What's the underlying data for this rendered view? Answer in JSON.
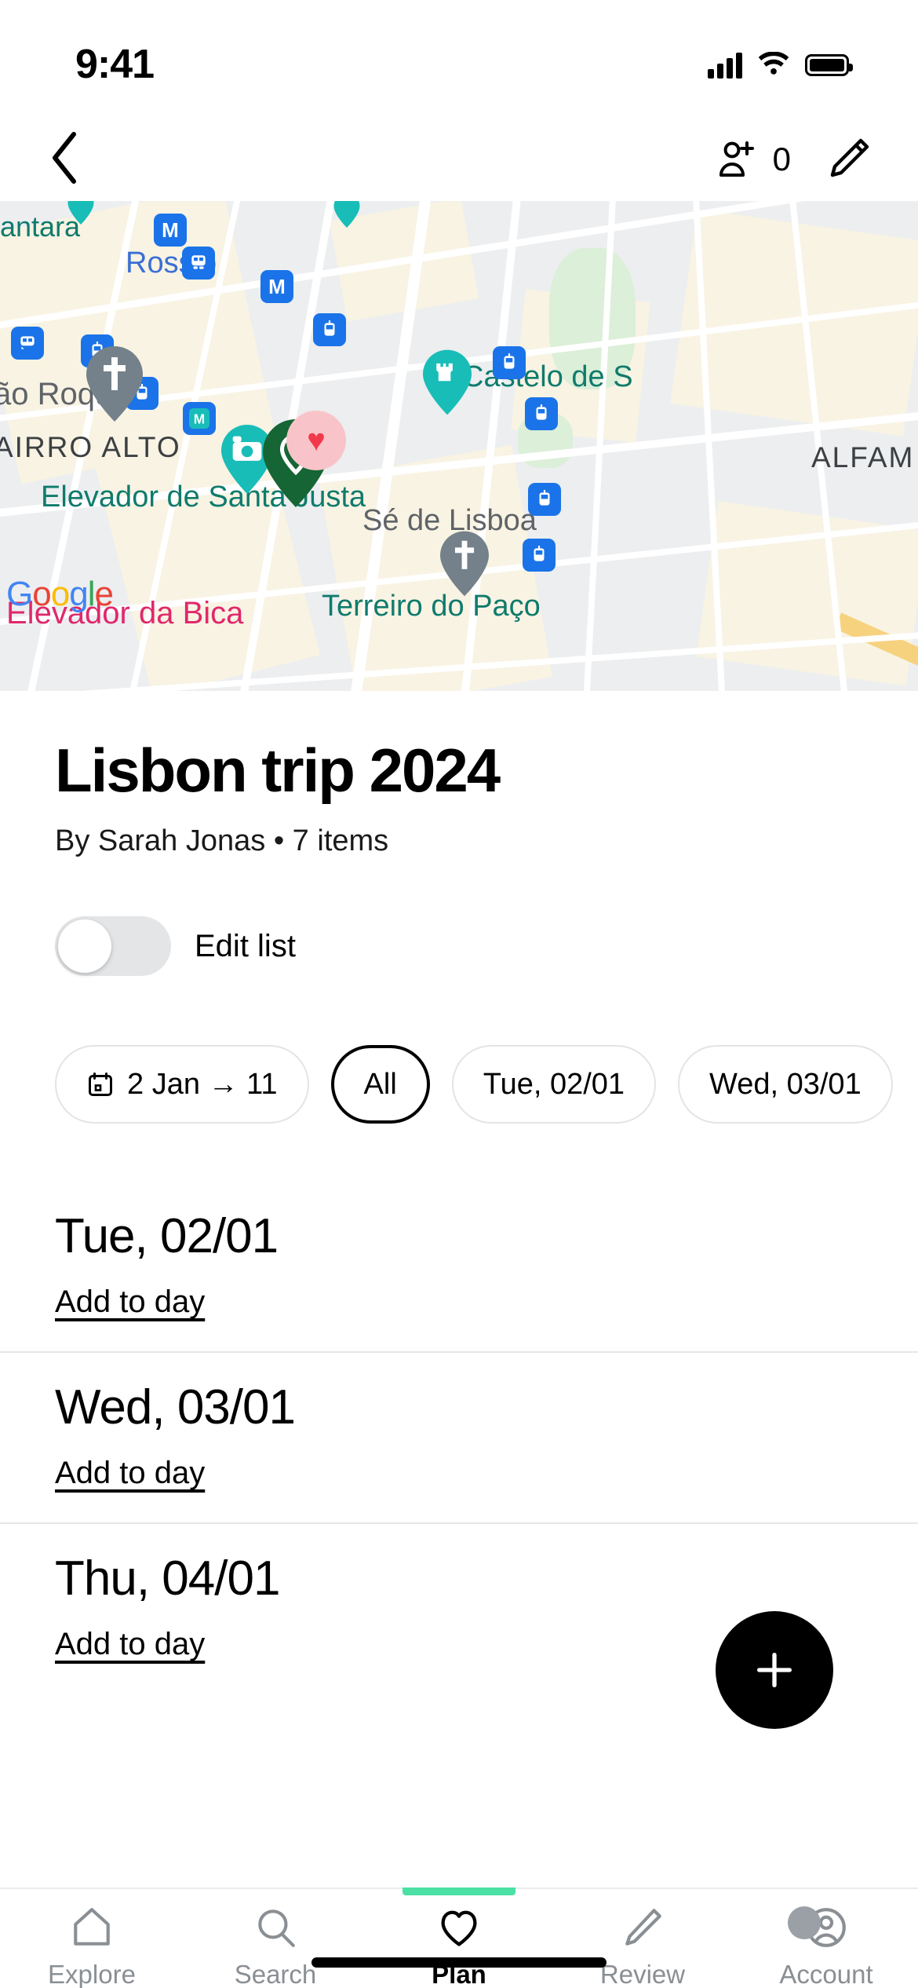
{
  "status_bar": {
    "time": "9:41",
    "signal_icon": "cellular-signal-icon",
    "wifi_icon": "wifi-icon",
    "battery_icon": "battery-icon"
  },
  "nav_bar": {
    "back_icon": "chevron-left-icon",
    "add_person_icon": "person-add-icon",
    "collaborator_count": "0",
    "edit_icon": "pencil-icon"
  },
  "map": {
    "provider": "Google",
    "provider_letters": [
      "G",
      "o",
      "o",
      "g",
      "l",
      "e"
    ],
    "labels": [
      {
        "text": "antara",
        "color": "#0f7b6c"
      },
      {
        "text": "Rossio",
        "color": "#3b6fd4"
      },
      {
        "text": "ão Roque",
        "color": "#5f6368"
      },
      {
        "text": "AIRRO ALTO",
        "color": "#3c4043"
      },
      {
        "text": "Elevador de Santa Justa",
        "color": "#0f7b6c"
      },
      {
        "text": "Castelo de S",
        "color": "#0f7b6c"
      },
      {
        "text": "ALFAM",
        "color": "#3c4043"
      },
      {
        "text": "Sé de Lisboa",
        "color": "#5f6368"
      },
      {
        "text": "Terreiro do Paço",
        "color": "#0f7b6c"
      },
      {
        "text": "Elevador da Bica",
        "color": "#e0286b"
      }
    ],
    "pins": [
      {
        "name": "church-pin",
        "glyph": "✝",
        "color": "#74818a"
      },
      {
        "name": "photo-spot-pin",
        "glyph": "📷",
        "color": "#18bdb8"
      },
      {
        "name": "saved-place-pin",
        "glyph": "◎",
        "color": "#166534"
      },
      {
        "name": "castle-pin",
        "glyph": "♜",
        "color": "#18bdb8"
      },
      {
        "name": "favourite-heart-pin",
        "glyph": "♥",
        "color": "#f2394c"
      },
      {
        "name": "church-pin-se",
        "glyph": "✝",
        "color": "#74818a"
      }
    ],
    "transit_icons": [
      {
        "name": "metro-icon",
        "label": "M"
      },
      {
        "name": "train-icon",
        "label": "🚆"
      },
      {
        "name": "tram-icon",
        "label": "🚋"
      }
    ]
  },
  "header": {
    "title": "Lisbon trip 2024",
    "subtitle": "By Sarah Jonas • 7 items"
  },
  "edit_toggle": {
    "label": "Edit list",
    "state": "off"
  },
  "filters": {
    "date_range_chip": {
      "icon": "calendar-icon",
      "label": "2 Jan → 11"
    },
    "chips": [
      {
        "label": "All",
        "selected": true
      },
      {
        "label": "Tue, 02/01",
        "selected": false
      },
      {
        "label": "Wed, 03/01",
        "selected": false
      }
    ]
  },
  "days": [
    {
      "title": "Tue, 02/01",
      "add_label": "Add to day"
    },
    {
      "title": "Wed, 03/01",
      "add_label": "Add to day"
    },
    {
      "title": "Thu, 04/01",
      "add_label": "Add to day"
    }
  ],
  "fab": {
    "icon": "plus-icon",
    "label": "+"
  },
  "tab_bar": {
    "active": "Plan",
    "accent_color": "#4ce0a5",
    "items": [
      {
        "label": "Explore",
        "icon": "home-icon",
        "active": false
      },
      {
        "label": "Search",
        "icon": "search-icon",
        "active": false
      },
      {
        "label": "Plan",
        "icon": "heart-icon",
        "active": true
      },
      {
        "label": "Review",
        "icon": "pencil-icon",
        "active": false
      },
      {
        "label": "Account",
        "icon": "account-avatar-icon",
        "active": false
      }
    ]
  }
}
